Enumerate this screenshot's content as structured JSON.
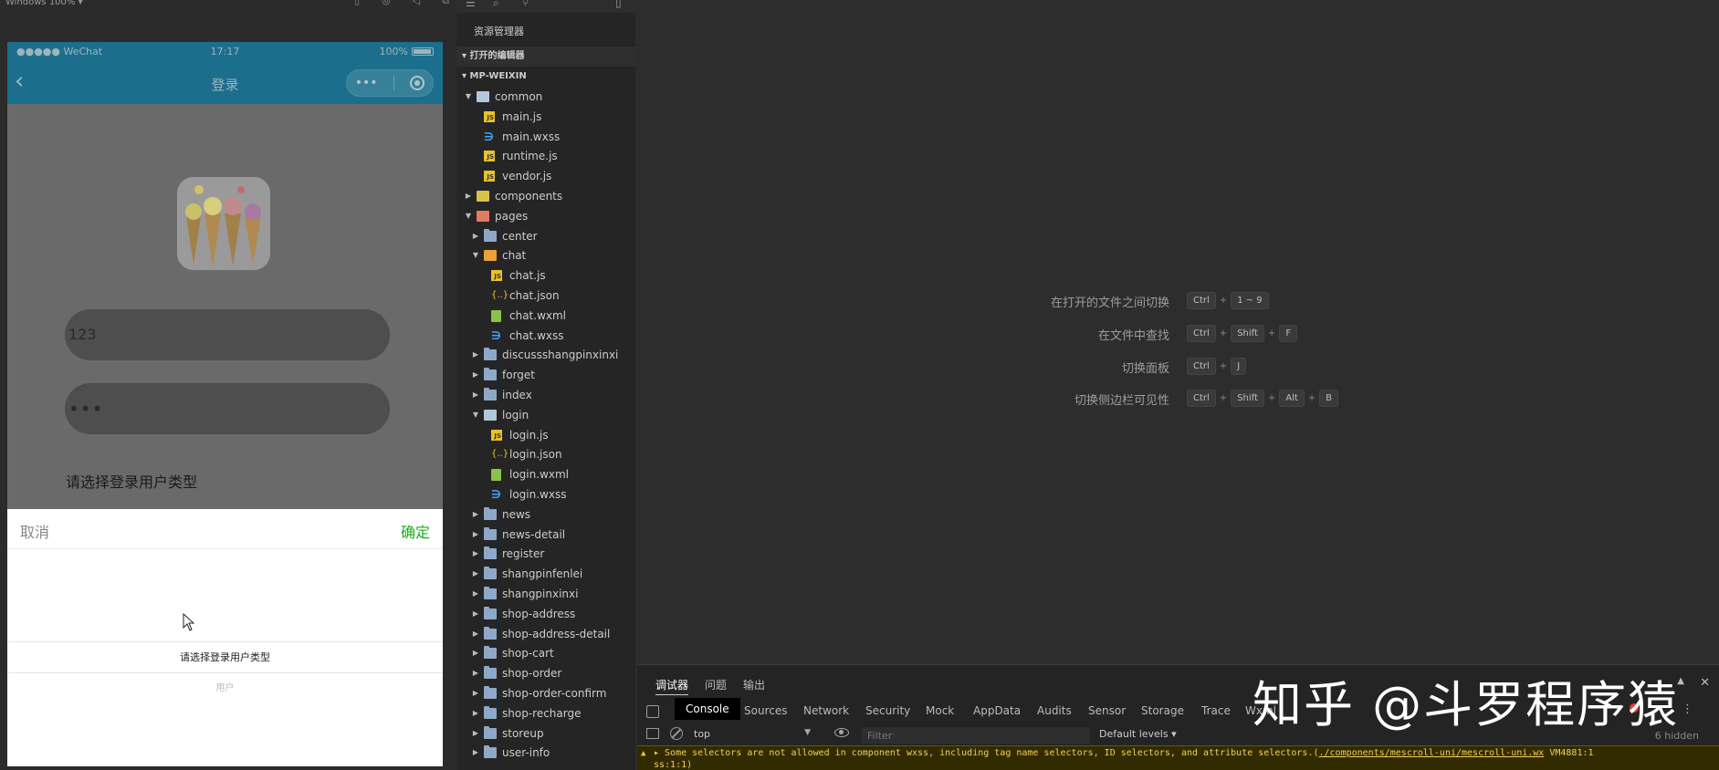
{
  "simulator": {
    "toolbar_label": "Windows 100% ▾",
    "status": {
      "carrier": "●●●●● WeChat",
      "time": "17:17",
      "battery": "100%"
    },
    "nav_title": "登录",
    "username_value": "123",
    "password_value": "•••",
    "role_label": "请选择登录用户类型",
    "picker": {
      "cancel": "取消",
      "confirm": "确定",
      "selected_option": "请选择登录用户类型",
      "next_option": "用户"
    }
  },
  "explorer": {
    "title": "资源管理器",
    "open_editors": "打开的编辑器",
    "project": "MP-WEIXIN",
    "tree": [
      {
        "label": "common",
        "depth": 1,
        "type": "folder-open",
        "expanded": true
      },
      {
        "label": "main.js",
        "depth": 2,
        "type": "js"
      },
      {
        "label": "main.wxss",
        "depth": 2,
        "type": "wxss"
      },
      {
        "label": "runtime.js",
        "depth": 2,
        "type": "js"
      },
      {
        "label": "vendor.js",
        "depth": 2,
        "type": "js"
      },
      {
        "label": "components",
        "depth": 1,
        "type": "folder-components",
        "expanded": false
      },
      {
        "label": "pages",
        "depth": 1,
        "type": "folder-pages",
        "expanded": true
      },
      {
        "label": "center",
        "depth": 2,
        "type": "folder",
        "expanded": false
      },
      {
        "label": "chat",
        "depth": 2,
        "type": "folder-chat",
        "expanded": true
      },
      {
        "label": "chat.js",
        "depth": 3,
        "type": "js"
      },
      {
        "label": "chat.json",
        "depth": 3,
        "type": "json"
      },
      {
        "label": "chat.wxml",
        "depth": 3,
        "type": "wxml"
      },
      {
        "label": "chat.wxss",
        "depth": 3,
        "type": "wxss"
      },
      {
        "label": "discussshangpinxinxi",
        "depth": 2,
        "type": "folder",
        "expanded": false
      },
      {
        "label": "forget",
        "depth": 2,
        "type": "folder",
        "expanded": false
      },
      {
        "label": "index",
        "depth": 2,
        "type": "folder",
        "expanded": false
      },
      {
        "label": "login",
        "depth": 2,
        "type": "folder-open",
        "expanded": true
      },
      {
        "label": "login.js",
        "depth": 3,
        "type": "js"
      },
      {
        "label": "login.json",
        "depth": 3,
        "type": "json"
      },
      {
        "label": "login.wxml",
        "depth": 3,
        "type": "wxml"
      },
      {
        "label": "login.wxss",
        "depth": 3,
        "type": "wxss"
      },
      {
        "label": "news",
        "depth": 2,
        "type": "folder",
        "expanded": false
      },
      {
        "label": "news-detail",
        "depth": 2,
        "type": "folder",
        "expanded": false
      },
      {
        "label": "register",
        "depth": 2,
        "type": "folder",
        "expanded": false
      },
      {
        "label": "shangpinfenlei",
        "depth": 2,
        "type": "folder",
        "expanded": false
      },
      {
        "label": "shangpinxinxi",
        "depth": 2,
        "type": "folder",
        "expanded": false
      },
      {
        "label": "shop-address",
        "depth": 2,
        "type": "folder",
        "expanded": false
      },
      {
        "label": "shop-address-detail",
        "depth": 2,
        "type": "folder",
        "expanded": false
      },
      {
        "label": "shop-cart",
        "depth": 2,
        "type": "folder",
        "expanded": false
      },
      {
        "label": "shop-order",
        "depth": 2,
        "type": "folder",
        "expanded": false
      },
      {
        "label": "shop-order-confirm",
        "depth": 2,
        "type": "folder",
        "expanded": false
      },
      {
        "label": "shop-recharge",
        "depth": 2,
        "type": "folder",
        "expanded": false
      },
      {
        "label": "storeup",
        "depth": 2,
        "type": "folder",
        "expanded": false
      },
      {
        "label": "user-info",
        "depth": 2,
        "type": "folder",
        "expanded": false
      }
    ]
  },
  "editor": {
    "hints": [
      {
        "text": "在打开的文件之间切换",
        "keys": [
          "Ctrl",
          "1 ~ 9"
        ]
      },
      {
        "text": "在文件中查找",
        "keys": [
          "Ctrl",
          "Shift",
          "F"
        ]
      },
      {
        "text": "切换面板",
        "keys": [
          "Ctrl",
          "J"
        ]
      },
      {
        "text": "切换侧边栏可见性",
        "keys": [
          "Ctrl",
          "Shift",
          "Alt",
          "B"
        ]
      }
    ]
  },
  "debugger": {
    "panel_tabs": [
      "调试器",
      "问题",
      "输出"
    ],
    "devtools_tabs": [
      "Console",
      "Sources",
      "Network",
      "Security",
      "Mock",
      "AppData",
      "Audits",
      "Sensor",
      "Storage",
      "Trace",
      "Wxml"
    ],
    "context": "top",
    "filter_placeholder": "Filter",
    "levels": "Default levels ▾",
    "hidden": "6 hidden",
    "warning_line1_pre": "▸ Some selectors are not allowed in component wxss, including tag name selectors, ID selectors, and attribute selectors.(",
    "warning_link": "./components/mescroll-uni/mescroll-uni.wx",
    "warning_line1_post": "  VM4881:1",
    "warning_line2": "ss:1:1)"
  },
  "watermark": "知乎 @斗罗程序猿",
  "colors": {
    "nav": "#1b6f8c",
    "confirm": "#1aad19",
    "warning_bg": "#332b00",
    "warning_text": "#f2d25b"
  }
}
